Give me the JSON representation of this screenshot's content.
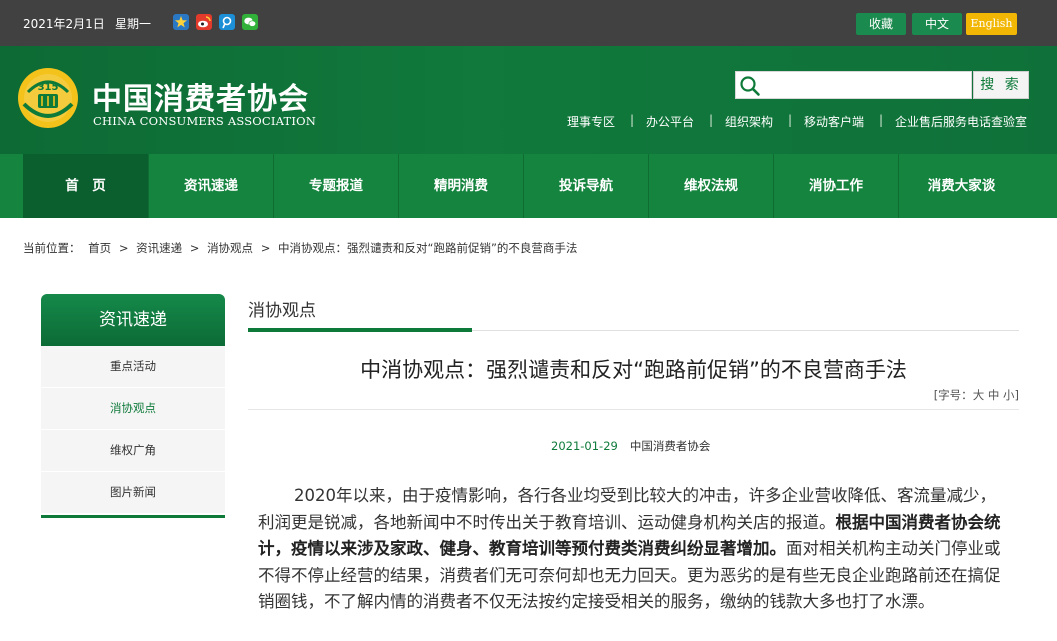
{
  "topbar": {
    "date": "2021年2月1日",
    "weekday": "星期一",
    "social_icons": [
      "qzone-icon",
      "weibo-icon",
      "tencent-weibo-icon",
      "wechat-icon"
    ],
    "favorite": "收藏",
    "chinese": "中文",
    "english": "English"
  },
  "header": {
    "name_cn": "中国消费者协会",
    "name_en": "CHINA CONSUMERS ASSOCIATION",
    "search_placeholder": "",
    "search_button": "搜 索",
    "links": [
      "理事专区",
      "办公平台",
      "组织架构",
      "移动客户端",
      "企业售后服务电话查验室"
    ]
  },
  "nav": {
    "items": [
      "首　页",
      "资讯速递",
      "专题报道",
      "精明消费",
      "投诉导航",
      "维权法规",
      "消协工作",
      "消费大家谈"
    ]
  },
  "breadcrumb": {
    "prefix": "当前位置：",
    "items": [
      "首页",
      "资讯速递",
      "消协观点",
      "中消协观点：强烈谴责和反对“跑路前促销”的不良营商手法"
    ]
  },
  "sidebar": {
    "title": "资讯速递",
    "items": [
      "重点活动",
      "消协观点",
      "维权广角",
      "图片新闻"
    ]
  },
  "main": {
    "section_title": "消协观点",
    "article_title": "中消协观点：强烈谴责和反对“跑路前促销”的不良营商手法",
    "font_size_label": "[字号：",
    "font_big": "大",
    "font_mid": "中",
    "font_small": "小",
    "font_close": "]",
    "date": "2021-01-29",
    "source": "中国消费者协会",
    "para_1": "2020年以来，由于疫情影响，各行各业均受到比较大的冲击，许多企业营收降低、客流量减少，利润更是锐减，各地新闻中不时传出关于教育培训、运动健身机构关店的报道。",
    "para_bold": "根据中国消费者协会统计，疫情以来涉及家政、健身、教育培训等预付费类消费纠纷显著增加。",
    "para_2": "面对相关机构主动关门停业或不得不停止经营的结果，消费者们无可奈何却也无力回天。更为恶劣的是有些无良企业跑路前还在搞促销圈钱，不了解内情的消费者不仅无法按约定接受相关的服务，缴纳的钱款大多也打了水漂。"
  },
  "colors": {
    "primary_green": "#0e7a3a",
    "nav_green": "#14843f",
    "topbar": "#414141",
    "english_btn": "#f2b705"
  }
}
